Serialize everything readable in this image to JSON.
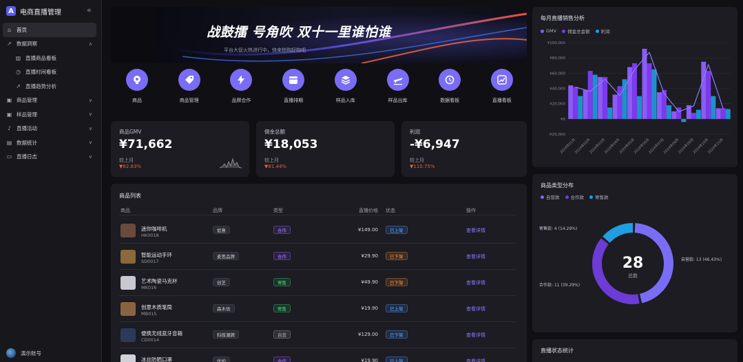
{
  "sidebar": {
    "title": "电商直播管理",
    "collapse_icon": "«",
    "items": [
      {
        "label": "首页",
        "icon": "home-icon",
        "active": true
      },
      {
        "label": "数据洞察",
        "icon": "trend-icon",
        "expand": "up"
      },
      {
        "label": "直播商品看板",
        "icon": "bar-icon",
        "sub": true
      },
      {
        "label": "直播时间看板",
        "icon": "clock-icon",
        "sub": true
      },
      {
        "label": "直播趋势分析",
        "icon": "trend-icon",
        "sub": true
      },
      {
        "label": "商品管理",
        "icon": "box-icon",
        "expand": "down"
      },
      {
        "label": "样品管理",
        "icon": "box-icon",
        "expand": "down"
      },
      {
        "label": "直播活动",
        "icon": "mic-icon",
        "expand": "down"
      },
      {
        "label": "数据统计",
        "icon": "chart-icon",
        "expand": "down"
      },
      {
        "label": "直播日志",
        "icon": "doc-icon",
        "expand": "down"
      }
    ],
    "user_name": "演示账号"
  },
  "banner": {
    "title": "战鼓擂 号角吹 双十一里谁怕谁",
    "subtitle": "平台大促火热进行中，快来抢购好物吧"
  },
  "quick_actions": [
    {
      "label": "商品",
      "icon": "bulb-icon"
    },
    {
      "label": "商品管理",
      "icon": "tag-icon"
    },
    {
      "label": "品牌合作",
      "icon": "bolt-icon"
    },
    {
      "label": "直播排期",
      "icon": "calendar-icon"
    },
    {
      "label": "样品入库",
      "icon": "layers-icon"
    },
    {
      "label": "样品出库",
      "icon": "plane-icon"
    },
    {
      "label": "数据看板",
      "icon": "refresh-icon"
    },
    {
      "label": "直播看板",
      "icon": "growth-icon"
    }
  ],
  "stats": [
    {
      "label": "商品GMV",
      "value": "¥71,662",
      "foot": "较上月",
      "delta": "▼82.83%",
      "sparkline": true
    },
    {
      "label": "佣金总额",
      "value": "¥18,053",
      "foot": "较上月",
      "delta": "▼81.44%"
    },
    {
      "label": "利润",
      "value": "-¥6,947",
      "foot": "较上月",
      "delta": "▼110.75%"
    }
  ],
  "products": {
    "title": "商品列表",
    "headers": [
      "商品",
      "品牌",
      "类型",
      "直播价格",
      "状态",
      "操作"
    ],
    "rows": [
      {
        "name": "迷你咖啡机",
        "code": "HK0018",
        "brand": "如意",
        "type": "合作",
        "price": "¥149.00",
        "status": "已上架",
        "action": "查看详情",
        "type_color": "purple",
        "status_color": "blue",
        "thumb": "#6a4a3a"
      },
      {
        "name": "智能运动手环",
        "code": "SD0017",
        "brand": "麦思品牌",
        "type": "合作",
        "price": "¥29.90",
        "status": "已下架",
        "action": "查看详情",
        "type_color": "purple",
        "status_color": "orange",
        "thumb": "#8a6a3a"
      },
      {
        "name": "艺术陶瓷马克杯",
        "code": "MK016",
        "brand": "创艺",
        "type": "寄售",
        "price": "¥49.90",
        "status": "已下架",
        "action": "查看详情",
        "type_color": "green",
        "status_color": "orange",
        "thumb": "#c8c8d0"
      },
      {
        "name": "创意木质笔筒",
        "code": "MB015",
        "brand": "森木坊",
        "type": "寄售",
        "price": "¥19.90",
        "status": "已上架",
        "action": "查看详情",
        "type_color": "green",
        "status_color": "blue",
        "thumb": "#8a6440"
      },
      {
        "name": "便携无线蓝牙音箱",
        "code": "CD0014",
        "brand": "科技潮牌",
        "type": "自营",
        "price": "¥129.00",
        "status": "已下架",
        "action": "查看详情",
        "type_color": "gray",
        "status_color": "blue",
        "thumb": "#2a3a5a"
      },
      {
        "name": "冰丝防晒口罩",
        "code": "FS0013",
        "brand": "优护",
        "type": "合作",
        "price": "¥19.90",
        "status": "已上架",
        "action": "查看详情",
        "type_color": "purple",
        "status_color": "blue",
        "thumb": "#d0d0d8"
      }
    ]
  },
  "colors": {
    "accent": "#7b6cf6",
    "gmv": "#8b5cf6",
    "commission": "#7c3aed",
    "profit": "#1f9fe0",
    "tag_purple": "#a78bfa",
    "tag_green": "#4ade80",
    "tag_orange": "#fb923c",
    "tag_blue": "#60a5fa",
    "delta_down": "#f25a3c"
  },
  "chart_data": [
    {
      "type": "bar",
      "title": "每月直播销售分析",
      "series": [
        {
          "name": "GMV",
          "values": [
            44000,
            38000,
            55000,
            32000,
            68000,
            92000,
            35000,
            10000,
            18000,
            75000,
            14000
          ]
        },
        {
          "name": "佣金总金额",
          "values": [
            42000,
            63000,
            55000,
            43000,
            73000,
            73000,
            38000,
            15000,
            8000,
            63000,
            14000
          ]
        },
        {
          "name": "利润",
          "values": [
            30000,
            58000,
            15000,
            52000,
            30000,
            65000,
            18000,
            -4000,
            12000,
            30000,
            13000
          ]
        }
      ],
      "line_series": "利润",
      "categories": [
        "2024年01月",
        "2024年02月",
        "2024年03月",
        "2024年04月",
        "2024年05月",
        "2024年06月",
        "2024年07月",
        "2024年08月",
        "2024年09月",
        "2024年10月",
        "2024年11月"
      ],
      "ylim": [
        -20000,
        100000
      ],
      "yticks": [
        "¥100,000",
        "¥80,000",
        "¥60,000",
        "¥40,000",
        "¥20,000",
        "¥0",
        "-¥20,000"
      ],
      "ytick_values": [
        100000,
        80000,
        60000,
        40000,
        20000,
        0,
        -20000
      ],
      "legend": "top-left",
      "grid": true
    },
    {
      "type": "pie",
      "title": "商品类型分布",
      "series": [
        {
          "name": "自营款",
          "value": 13,
          "label": "自营款: 13 (46.43%)"
        },
        {
          "name": "合作款",
          "value": 11,
          "label": "合作款: 11 (39.29%)"
        },
        {
          "name": "寄售款",
          "value": 4,
          "label": "寄售款: 4 (14.29%)"
        }
      ],
      "center_value": "28",
      "center_label": "总数",
      "legend": "top-left"
    }
  ],
  "live_stats": {
    "title": "直播状态统计"
  }
}
